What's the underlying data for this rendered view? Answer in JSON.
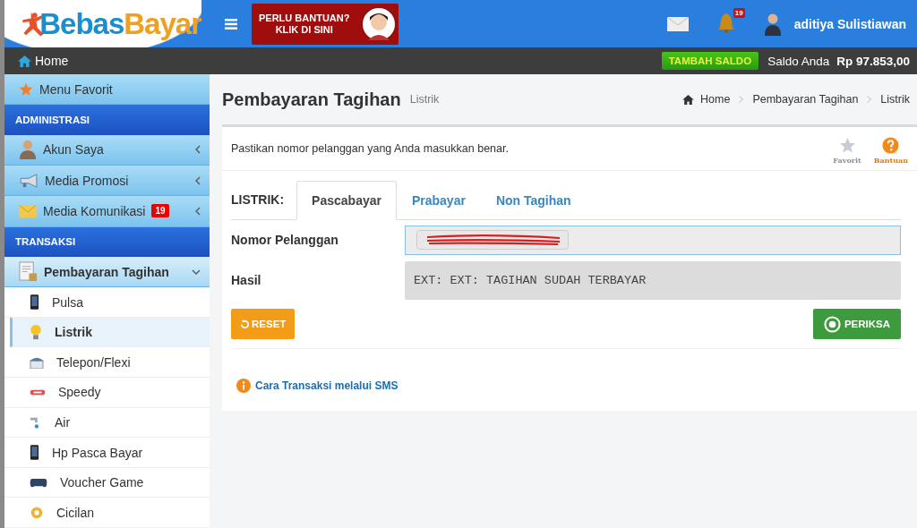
{
  "header": {
    "logo": [
      "Bebas",
      "Bayar"
    ],
    "help_banner": [
      "PERLU BANTUAN?",
      "KLIK DI SINI"
    ],
    "notification_count": "19",
    "user_name": "aditiya Sulistiawan"
  },
  "topbar": {
    "home": "Home",
    "topup_button": "TAMBAH SALDO",
    "balance_label": "Saldo Anda",
    "balance": "Rp 97.853,00"
  },
  "sidebar": {
    "items": [
      {
        "kind": "favorite",
        "label": "Menu Favorit"
      },
      {
        "kind": "section",
        "label": "ADMINISTRASI"
      },
      {
        "kind": "menu",
        "label": "Akun Saya",
        "expanded": false
      },
      {
        "kind": "menu",
        "label": "Media Promosi",
        "expanded": false
      },
      {
        "kind": "menu",
        "label": "Media Komunikasi",
        "badge": "19",
        "expanded": false
      },
      {
        "kind": "section",
        "label": "TRANSAKSI"
      },
      {
        "kind": "menu",
        "label": "Pembayaran Tagihan",
        "expanded": true,
        "children": [
          {
            "label": "Pulsa",
            "selected": false
          },
          {
            "label": "Listrik",
            "selected": true
          },
          {
            "label": "Telepon/Flexi",
            "selected": false
          },
          {
            "label": "Speedy",
            "selected": false
          },
          {
            "label": "Air",
            "selected": false
          },
          {
            "label": "Hp Pasca Bayar",
            "selected": false
          },
          {
            "label": "Voucher Game",
            "selected": false
          },
          {
            "label": "Cicilan",
            "selected": false
          }
        ]
      }
    ]
  },
  "page": {
    "title": "Pembayaran Tagihan",
    "subtitle": "Listrik",
    "breadcrumb": [
      "Home",
      "Pembayaran Tagihan",
      "Listrik"
    ]
  },
  "panel": {
    "notice": "Pastikan nomor pelanggan yang Anda masukkan benar.",
    "actions": [
      {
        "kind": "favorite",
        "label": "Favorit"
      },
      {
        "kind": "help",
        "label": "Bantuan"
      }
    ],
    "tabs_label": "LISTRIK:",
    "tabs": [
      {
        "label": "Pascabayar",
        "selected": true
      },
      {
        "label": "Prabayar",
        "selected": false
      },
      {
        "label": "Non Tagihan",
        "selected": false
      }
    ],
    "fields": [
      {
        "kind": "input",
        "label": "Nomor Pelanggan",
        "redacted": true
      },
      {
        "kind": "output",
        "label": "Hasil",
        "value": "EXT: EXT: TAGIHAN SUDAH TERBAYAR"
      }
    ],
    "reset_button": "RESET",
    "check_button": "PERIKSA",
    "sms_link": "Cara Transaksi melalui SMS"
  }
}
